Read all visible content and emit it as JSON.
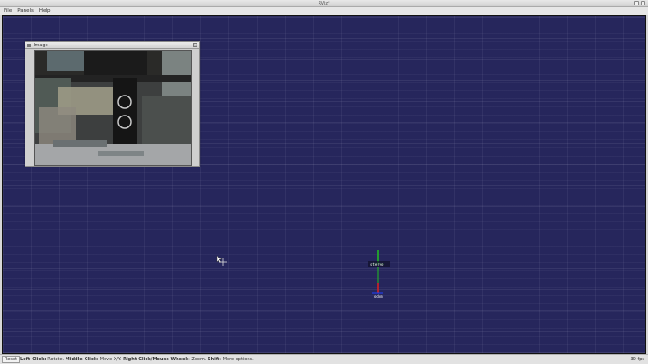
{
  "window": {
    "title": "RViz*"
  },
  "menu": {
    "items": [
      "File",
      "Panels",
      "Help"
    ]
  },
  "image_panel": {
    "title": "Image"
  },
  "frames": {
    "upper_label": "stereo",
    "lower_label": "odom"
  },
  "statusbar": {
    "reset_label": "Reset",
    "left_click": "Left-Click:",
    "left_click_desc": " Rotate. ",
    "middle_click": "Middle-Click:",
    "middle_click_desc": " Move X/Y. ",
    "right_click": "Right-Click/Mouse Wheel:",
    "right_click_desc": ": Zoom. ",
    "shift": "Shift",
    "shift_desc": ": More options.",
    "fps": "30 fps"
  },
  "colors": {
    "viewport_bg": "#26265c",
    "axis_x": "#e02020",
    "axis_y": "#20c020",
    "axis_z": "#2040ff"
  }
}
